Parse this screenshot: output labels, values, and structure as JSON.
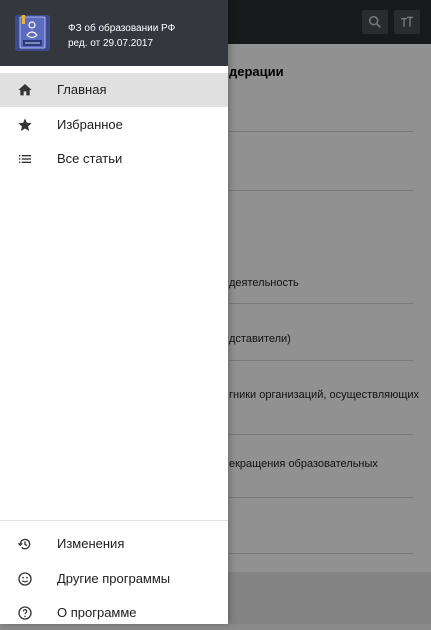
{
  "background": {
    "heading": "дерации",
    "lines": [
      "деятельность",
      "дставители)",
      "гники организаций, осуществляющих",
      "екращения образовательных"
    ],
    "toolbar_icons": [
      "search-icon",
      "text-size-icon"
    ]
  },
  "drawer": {
    "app_title": "ФЗ об образовании РФ",
    "app_subtitle": "ред. от 29.07.2017",
    "items": [
      {
        "label": "Главная",
        "icon": "home-icon",
        "active": true
      },
      {
        "label": "Избранное",
        "icon": "star-icon",
        "active": false
      },
      {
        "label": "Все статьи",
        "icon": "list-icon",
        "active": false
      }
    ],
    "footer_items": [
      {
        "label": "Изменения",
        "icon": "history-icon"
      },
      {
        "label": "Другие программы",
        "icon": "smiley-icon"
      },
      {
        "label": "О программе",
        "icon": "help-icon"
      }
    ]
  },
  "colors": {
    "header_bg": "#34373d",
    "toolbar_bg": "#2b2d31",
    "active_item_bg": "#e0e0e0",
    "app_icon_bg": "#3d4a8c"
  }
}
